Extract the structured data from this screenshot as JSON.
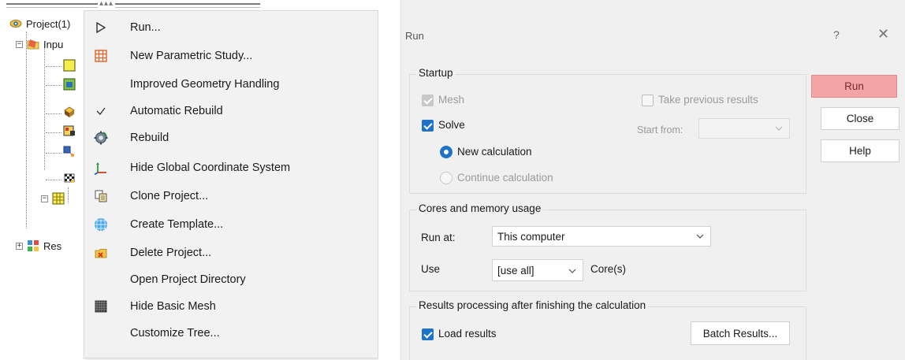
{
  "tree": {
    "topbar_dots": "▴▴▴",
    "root_label": "Project(1)",
    "input_label": "Inpu",
    "results_label": "Res"
  },
  "context_menu": {
    "items": [
      {
        "label": "Run...",
        "icon": "play-icon"
      },
      {
        "label": "New Parametric Study...",
        "icon": "parametric-grid-icon"
      },
      {
        "label": "Improved Geometry Handling",
        "icon": ""
      },
      {
        "label": "Automatic Rebuild",
        "icon": "checkmark-icon",
        "checked": true
      },
      {
        "label": "Rebuild",
        "icon": "rebuild-gear-icon"
      },
      {
        "label": "Hide Global Coordinate System",
        "icon": "coordinate-axes-icon"
      },
      {
        "label": "Clone Project...",
        "icon": "clone-icon"
      },
      {
        "label": "Create Template...",
        "icon": "template-sphere-icon"
      },
      {
        "label": "Delete Project...",
        "icon": "delete-folder-icon"
      },
      {
        "label": "Open Project Directory",
        "icon": ""
      },
      {
        "label": "Hide Basic Mesh",
        "icon": "basic-mesh-icon"
      },
      {
        "label": "Customize Tree...",
        "icon": ""
      }
    ]
  },
  "run_dialog": {
    "title": "Run",
    "help_glyph": "?",
    "close_glyph": "✕",
    "startup": {
      "title": "Startup",
      "mesh_label": "Mesh",
      "solve_label": "Solve",
      "new_calc_label": "New calculation",
      "continue_calc_label": "Continue calculation",
      "take_previous_label": "Take previous results",
      "start_from_label": "Start from:",
      "start_from_value": ""
    },
    "cores": {
      "title": "Cores and memory usage",
      "run_at_label": "Run at:",
      "run_at_value": "This computer",
      "use_label": "Use",
      "use_value": "[use all]",
      "cores_suffix": "Core(s)"
    },
    "results": {
      "title": "Results processing after finishing the calculation",
      "load_results_label": "Load results",
      "batch_button": "Batch Results..."
    },
    "buttons": {
      "run": "Run",
      "close": "Close",
      "help": "Help"
    }
  },
  "colors": {
    "accent_blue": "#1e73c8",
    "run_button": "#f3a4a4",
    "dialog_bg": "#f0f0f0",
    "menu_bg": "#f2f2f2"
  }
}
